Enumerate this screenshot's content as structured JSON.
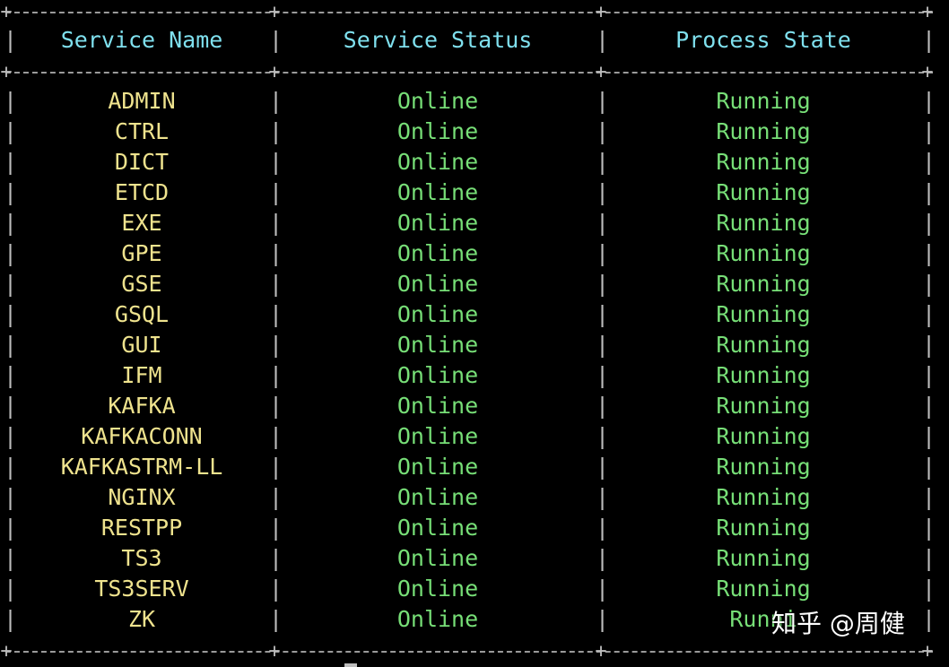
{
  "table": {
    "headers": {
      "service_name": "Service Name",
      "service_status": "Service Status",
      "process_state": "Process State"
    },
    "rows": [
      {
        "name": "ADMIN",
        "status": "Online",
        "state": "Running"
      },
      {
        "name": "CTRL",
        "status": "Online",
        "state": "Running"
      },
      {
        "name": "DICT",
        "status": "Online",
        "state": "Running"
      },
      {
        "name": "ETCD",
        "status": "Online",
        "state": "Running"
      },
      {
        "name": "EXE",
        "status": "Online",
        "state": "Running"
      },
      {
        "name": "GPE",
        "status": "Online",
        "state": "Running"
      },
      {
        "name": "GSE",
        "status": "Online",
        "state": "Running"
      },
      {
        "name": "GSQL",
        "status": "Online",
        "state": "Running"
      },
      {
        "name": "GUI",
        "status": "Online",
        "state": "Running"
      },
      {
        "name": "IFM",
        "status": "Online",
        "state": "Running"
      },
      {
        "name": "KAFKA",
        "status": "Online",
        "state": "Running"
      },
      {
        "name": "KAFKACONN",
        "status": "Online",
        "state": "Running"
      },
      {
        "name": "KAFKASTRM-LL",
        "status": "Online",
        "state": "Running"
      },
      {
        "name": "NGINX",
        "status": "Online",
        "state": "Running"
      },
      {
        "name": "RESTPP",
        "status": "Online",
        "state": "Running"
      },
      {
        "name": "TS3",
        "status": "Online",
        "state": "Running"
      },
      {
        "name": "TS3SERV",
        "status": "Online",
        "state": "Running"
      },
      {
        "name": "ZK",
        "status": "Online",
        "state": "Runni"
      }
    ]
  },
  "watermark": "知乎 @周健",
  "colors": {
    "background": "#000000",
    "header_text": "#7fe0ee",
    "service_name_text": "#efe38e",
    "status_text": "#77df77",
    "border": "#bdbdbd"
  }
}
